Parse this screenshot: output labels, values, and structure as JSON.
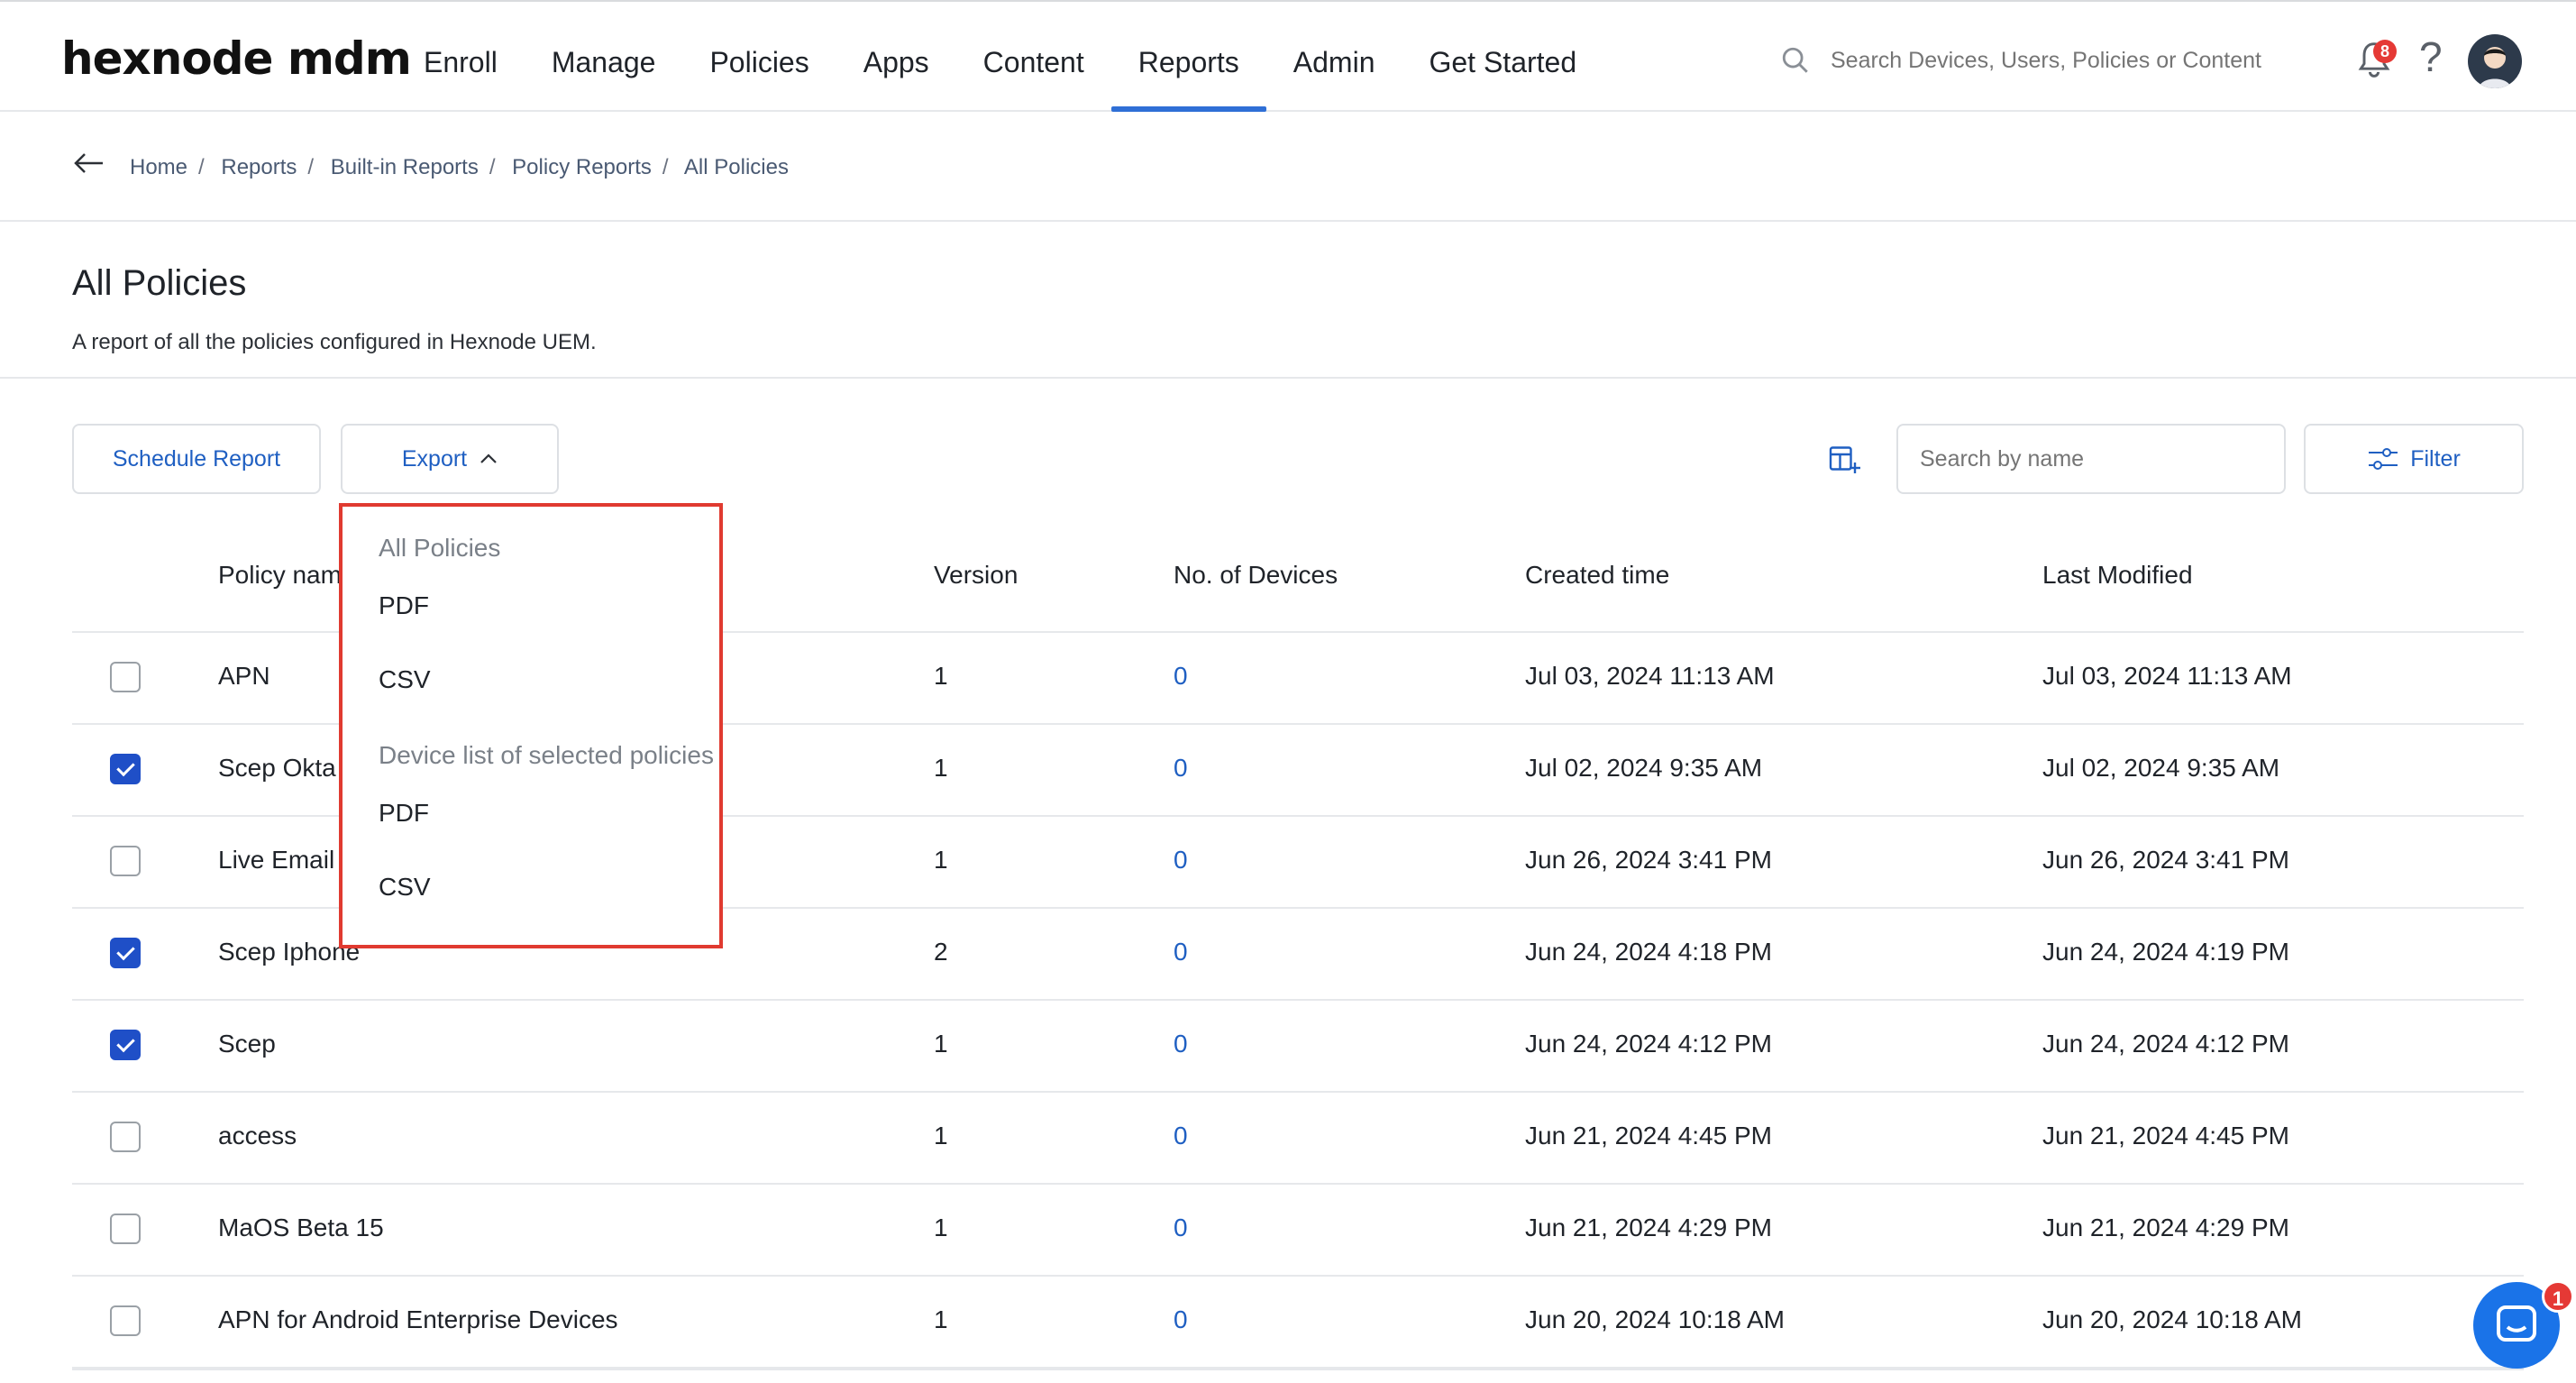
{
  "app": {
    "logo": "hexnode mdm"
  },
  "nav": [
    "Enroll",
    "Manage",
    "Policies",
    "Apps",
    "Content",
    "Reports",
    "Admin",
    "Get Started"
  ],
  "nav_active": "Reports",
  "header": {
    "search_placeholder": "Search Devices, Users, Policies or Content",
    "notification_count": "8"
  },
  "breadcrumb": [
    "Home",
    "Reports",
    "Built-in Reports",
    "Policy Reports",
    "All Policies"
  ],
  "page": {
    "title": "All Policies",
    "description": "A report of all the policies configured in Hexnode UEM."
  },
  "toolbar": {
    "schedule_label": "Schedule Report",
    "export_label": "Export",
    "search_placeholder": "Search by name",
    "filter_label": "Filter"
  },
  "export_menu": {
    "group1": "All Policies",
    "group1_items": [
      "PDF",
      "CSV"
    ],
    "group2": "Device list of selected policies",
    "group2_items": [
      "PDF",
      "CSV"
    ]
  },
  "table": {
    "headers": [
      "Policy name",
      "Version",
      "No. of Devices",
      "Created time",
      "Last Modified"
    ],
    "rows": [
      {
        "checked": false,
        "name": "APN",
        "version": "1",
        "devices": "0",
        "created": "Jul 03, 2024 11:13 AM",
        "modified": "Jul 03, 2024 11:13 AM"
      },
      {
        "checked": true,
        "name": "Scep Okta",
        "version": "1",
        "devices": "0",
        "created": "Jul 02, 2024 9:35 AM",
        "modified": "Jul 02, 2024 9:35 AM"
      },
      {
        "checked": false,
        "name": "Live Email",
        "version": "1",
        "devices": "0",
        "created": "Jun 26, 2024 3:41 PM",
        "modified": "Jun 26, 2024 3:41 PM"
      },
      {
        "checked": true,
        "name": "Scep Iphone",
        "version": "2",
        "devices": "0",
        "created": "Jun 24, 2024 4:18 PM",
        "modified": "Jun 24, 2024 4:19 PM"
      },
      {
        "checked": true,
        "name": "Scep",
        "version": "1",
        "devices": "0",
        "created": "Jun 24, 2024 4:12 PM",
        "modified": "Jun 24, 2024 4:12 PM"
      },
      {
        "checked": false,
        "name": "access",
        "version": "1",
        "devices": "0",
        "created": "Jun 21, 2024 4:45 PM",
        "modified": "Jun 21, 2024 4:45 PM"
      },
      {
        "checked": false,
        "name": "MaOS Beta 15",
        "version": "1",
        "devices": "0",
        "created": "Jun 21, 2024 4:29 PM",
        "modified": "Jun 21, 2024 4:29 PM"
      },
      {
        "checked": false,
        "name": "APN for Android Enterprise Devices",
        "version": "1",
        "devices": "0",
        "created": "Jun 20, 2024 10:18 AM",
        "modified": "Jun 20, 2024 10:18 AM"
      }
    ]
  },
  "chat": {
    "badge": "1"
  },
  "colors": {
    "accent": "#1f5fc2",
    "highlight": "#e03a30",
    "checkbox": "#1f4fc7"
  }
}
